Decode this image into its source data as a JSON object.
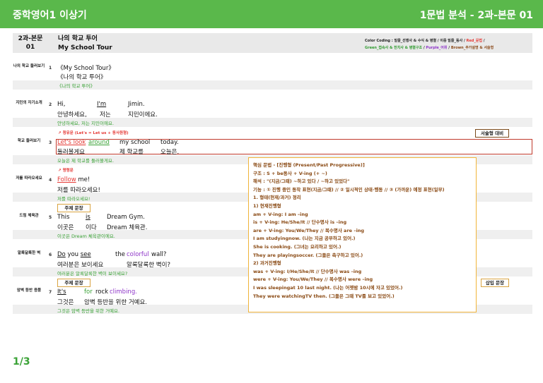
{
  "header": {
    "left": "중학영어1 이상기",
    "right": "1문법 분석 - 2과-본문 01"
  },
  "lesson": {
    "code_line1": "2과-본문",
    "code_line2": "01",
    "title_ko": "나의 학교 투어",
    "title_en": "My School Tour"
  },
  "color_coding": {
    "line1_a": "Color Coding : 밑줄_선행사 & 수식 & 병렬 / 이중 밑줄_동사 / ",
    "line1_red": "Red_문법",
    "line1_b": " /",
    "line2_green": "Green_접속사 & 전치사 & 병렬구조",
    "line2_a": " / ",
    "line2_purple": "Purple_어휘",
    "line2_b": " / ",
    "line2_brown": "Brown_추가설명 & 서술형"
  },
  "rows": [
    {
      "label": "나의 학교 둘러보기",
      "num": "1",
      "en": "《My School Tour》",
      "ko": "《나의 학교 투어》",
      "tr": "《나의 학교 투어》"
    },
    {
      "label": "지민의 자기소개",
      "num": "2",
      "en_a": "Hi,",
      "en_b": "I'm",
      "en_c": "Jimin.",
      "ko_a": "안녕하세요,",
      "ko_b": "저는",
      "ko_c": "지민이에요.",
      "tr": "안녕하세요, 저는 지민이에요."
    },
    {
      "label": "학교 둘러보기",
      "num": "3",
      "note": "청유문 (Let's = Let us + 동사원형)",
      "en_a": "Let's look",
      "en_b": "around",
      "en_c": "my school",
      "en_d": "today.",
      "ko_a": "둘러볼게요",
      "ko_b": "제 학교를",
      "ko_c": "오늘은.",
      "tr": "오늘은 제 학교를 둘러볼게요."
    },
    {
      "label": "저를 따라오세요",
      "num": "4",
      "note": "명령문",
      "en_a": "Follow",
      "en_b": " me!",
      "ko": "저를 따라오세요!",
      "tr": "저를 따라오세요!"
    },
    {
      "label": "드림 체육관",
      "num": "5",
      "en_a": "This",
      "en_b": "is",
      "en_c": "Dream Gym.",
      "ko_a": "이곳은",
      "ko_b": "이다",
      "ko_c": "Dream 체육관.",
      "tr": "이곳은 Dream 체육관이에요."
    },
    {
      "label": "알록달록한 벽",
      "num": "6",
      "en_a": "Do",
      "en_b": " you ",
      "en_c": "see",
      "en_d": "the",
      "en_e": "colorful",
      "en_f": "wall?",
      "ko_a": "여러분은 보이세요",
      "ko_b": "알록달록한 벽이?",
      "tr": "여러분은 알록달록한 벽이 보이세요?"
    },
    {
      "label": "암벽 등반 용품",
      "num": "7",
      "en_a": "It's",
      "en_b": "for",
      "en_c": "rock",
      "en_d": "climbing.",
      "ko_a": "그것은",
      "ko_b": "암벽 등반을 위한 거예요.",
      "tr": "그것은 암벽 등반을 위한 거예요."
    }
  ],
  "tags": {
    "descriptive": "서술형 대비",
    "subject": "주제 문장",
    "insert": "삽입 문장"
  },
  "grammar": [
    "핵심 문법 - [진행형 (Present/Past Progressive)]",
    "구조 : S + be동사 + V-ing (+ ~)",
    "해석 : \"(지금/그때) ~하고 있다 / ~하고 있었다\"",
    "기능 : ① 진행 중인 동작 표현(지금/그때) // ② 일시적인 상태·행동 // ③ (가까운) 예정 표현(일부)",
    "1. 형태(현재/과거) 정리",
    "1) 현재진행형",
    "am + V-ing: I am –ing",
    "is + V-ing: He/She/It // 단수명사 is –ing",
    "are + V-ing: You/We/They // 복수명사 are –ing",
    "I am studyingnow. (나는 지금 공부하고 있어.)",
    "She is cooking. (그녀는 요리하고 있어.)",
    "They are playingsoccer. (그들은 축구하고 있어.)",
    "2) 과거진행형",
    "was + V-ing: I/He/She/It // 단수명사 was –ing",
    "were + V-ing: You/We/They // 복수명사 were –ing",
    "I was sleepingat 10 last night. (나는 어젯밤 10시에 자고 있었어.)",
    "They were watchingTV then. (그들은 그때 TV를 보고 있었어.)"
  ],
  "page": "1/3",
  "colors": {
    "green": "#5ab84b",
    "red": "#e53935",
    "purple": "#8e35c8",
    "brown": "#8b4a1a",
    "orange": "#f0b43a"
  }
}
